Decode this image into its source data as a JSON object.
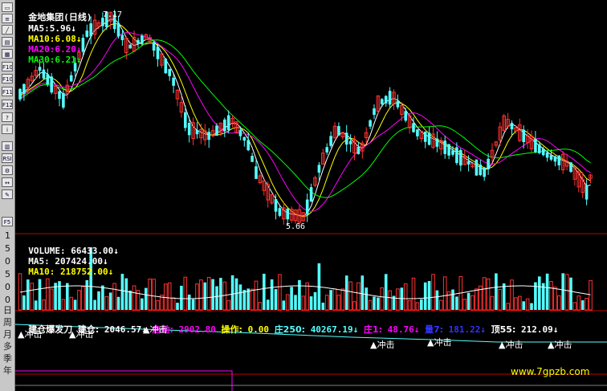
{
  "main_header": {
    "stock_name": "金地集团",
    "period": "(日线)",
    "ma5_label": "MA5:",
    "ma5_value": "5.96↓",
    "ma10_label": "MA10:",
    "ma10_value": "6.08↓",
    "ma20_label": "MA20:",
    "ma20_value": "6.20↓",
    "ma30_label": "MA30:",
    "ma30_value": "6.21↓"
  },
  "price_annotations": {
    "high": "7.17",
    "low": "5.66"
  },
  "volume_header": {
    "volume_label": "VOLUME:",
    "volume_value": "66433.00↓",
    "ma5_label": "MA5:",
    "ma5_value": "207424.00↓",
    "ma10_label": "MA10:",
    "ma10_value": "218752.00↓"
  },
  "indicator_header": {
    "name": "建仓爆发刀",
    "jc_label": "建仓:",
    "jc_value": "2046.57↓",
    "qd_label": "启动:",
    "qd_value": "2902.80",
    "cz_label": "操作:",
    "cz_value": "0.00",
    "z250_label": "庄250:",
    "z250_value": "40267.19↓",
    "z1_label": "庄1:",
    "z1_value": "48.76↓",
    "l7_label": "量7:",
    "l7_value": "181.22↓",
    "d55_label": "顶55:",
    "d55_value": "212.09↓"
  },
  "signal_label": "▲冲击",
  "volume_axis": [
    "1",
    "5",
    "0",
    "5",
    "0",
    "0",
    "0",
    "0",
    "0"
  ],
  "toolbar_text": [
    "日",
    "周",
    "月",
    "多",
    "季",
    "年"
  ],
  "toolbar_icons": [
    "window-icon",
    "list-icon",
    "chart-icon",
    "news-icon",
    "calc-icon",
    "f10-icon",
    "f10b-icon",
    "f11-icon",
    "f12-icon",
    "search-icon",
    "info-icon",
    "grid-icon",
    "rsi-icon",
    "tool-icon",
    "arrow-icon",
    "pen-icon",
    "f5-icon"
  ],
  "watermark": "www.7gpzb.com",
  "colors": {
    "up": "#ff3232",
    "down": "#54ffff",
    "ma5": "#ffffff",
    "ma10": "#ffff00",
    "ma20": "#ff00ff",
    "ma30": "#00ff00",
    "axis_line": "#c00000"
  }
}
